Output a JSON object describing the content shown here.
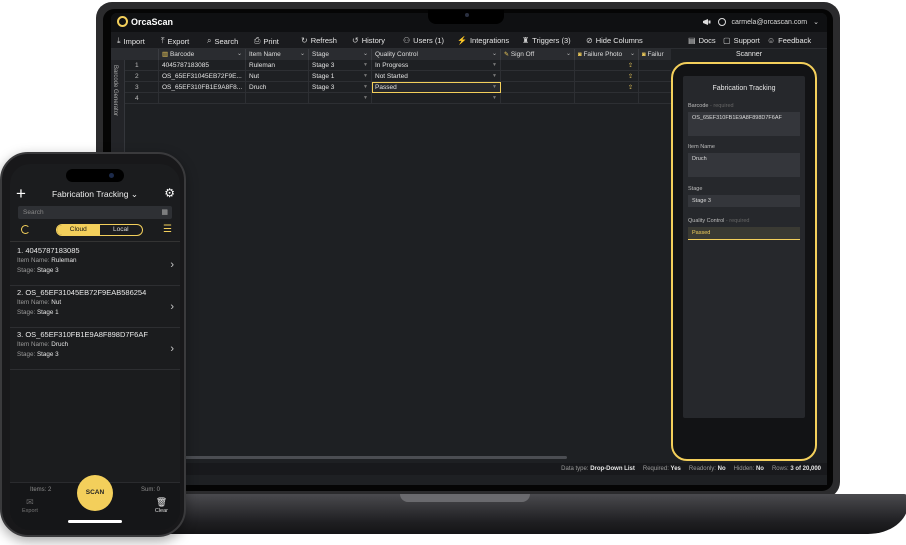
{
  "app": {
    "name": "OrcaScan",
    "user_email": "carmela@orcascan.com"
  },
  "toolbar": {
    "import": "Import",
    "export": "Export",
    "search": "Search",
    "print": "Print",
    "refresh": "Refresh",
    "history": "History",
    "users": "Users (1)",
    "integrations": "Integrations",
    "triggers": "Triggers (3)",
    "hide_columns": "Hide Columns",
    "docs": "Docs",
    "support": "Support",
    "feedback": "Feedback"
  },
  "sidebar": {
    "label": "Barcode Generator"
  },
  "grid": {
    "columns": [
      "Barcode",
      "Item Name",
      "Stage",
      "Quality Control",
      "Sign Off",
      "Failure Photo",
      "Failur"
    ],
    "rows": [
      {
        "num": "1",
        "barcode": "4045787183085",
        "item": "Ruleman",
        "stage": "Stage 3",
        "qc": "In Progress"
      },
      {
        "num": "2",
        "barcode": "OS_65EF31045EB72F9E...",
        "item": "Nut",
        "stage": "Stage 1",
        "qc": "Not Started"
      },
      {
        "num": "3",
        "barcode": "OS_65EF310FB1E9A8F8...",
        "item": "Druch",
        "stage": "Stage 3",
        "qc": "Passed"
      },
      {
        "num": "4",
        "barcode": "",
        "item": "",
        "stage": "",
        "qc": ""
      }
    ]
  },
  "status": {
    "data_type_label": "Data type:",
    "data_type_value": "Drop-Down List",
    "required_label": "Required:",
    "required_value": "Yes",
    "readonly_label": "Readonly:",
    "readonly_value": "No",
    "hidden_label": "Hidden:",
    "hidden_value": "No",
    "rows_label": "Rows:",
    "rows_value": "3 of 20,000"
  },
  "scanner": {
    "panel_title": "Scanner",
    "sheet_title": "Fabrication Tracking",
    "fields": [
      {
        "label": "Barcode",
        "req": "- required",
        "value": "OS_65EF310FB1E9A8F898D7F6AF"
      },
      {
        "label": "Item Name",
        "req": "",
        "value": "Druch"
      },
      {
        "label": "Stage",
        "req": "",
        "value": "Stage 3"
      },
      {
        "label": "Quality Control",
        "req": "- required",
        "value": "Passed"
      }
    ]
  },
  "phone": {
    "sheet_title": "Fabrication Tracking",
    "search_placeholder": "Search",
    "seg_cloud": "Cloud",
    "seg_local": "Local",
    "items": [
      {
        "title": "1. 4045787183085",
        "item_label": "Item Name:",
        "item_value": "Ruleman",
        "stage_label": "Stage:",
        "stage_value": "Stage 3"
      },
      {
        "title": "2. OS_65EF31045EB72F9EAB586254",
        "item_label": "Item Name:",
        "item_value": "Nut",
        "stage_label": "Stage:",
        "stage_value": "Stage 1"
      },
      {
        "title": "3. OS_65EF310FB1E9A8F898D7F6AF",
        "item_label": "Item Name:",
        "item_value": "Druch",
        "stage_label": "Stage:",
        "stage_value": "Stage 3"
      }
    ],
    "items_count": "Items: 2",
    "sum": "Sum: 0",
    "scan": "SCAN",
    "export": "Export",
    "clear": "Clear"
  },
  "colors": {
    "accent": "#f3cf5b",
    "background": "#1e2023"
  }
}
